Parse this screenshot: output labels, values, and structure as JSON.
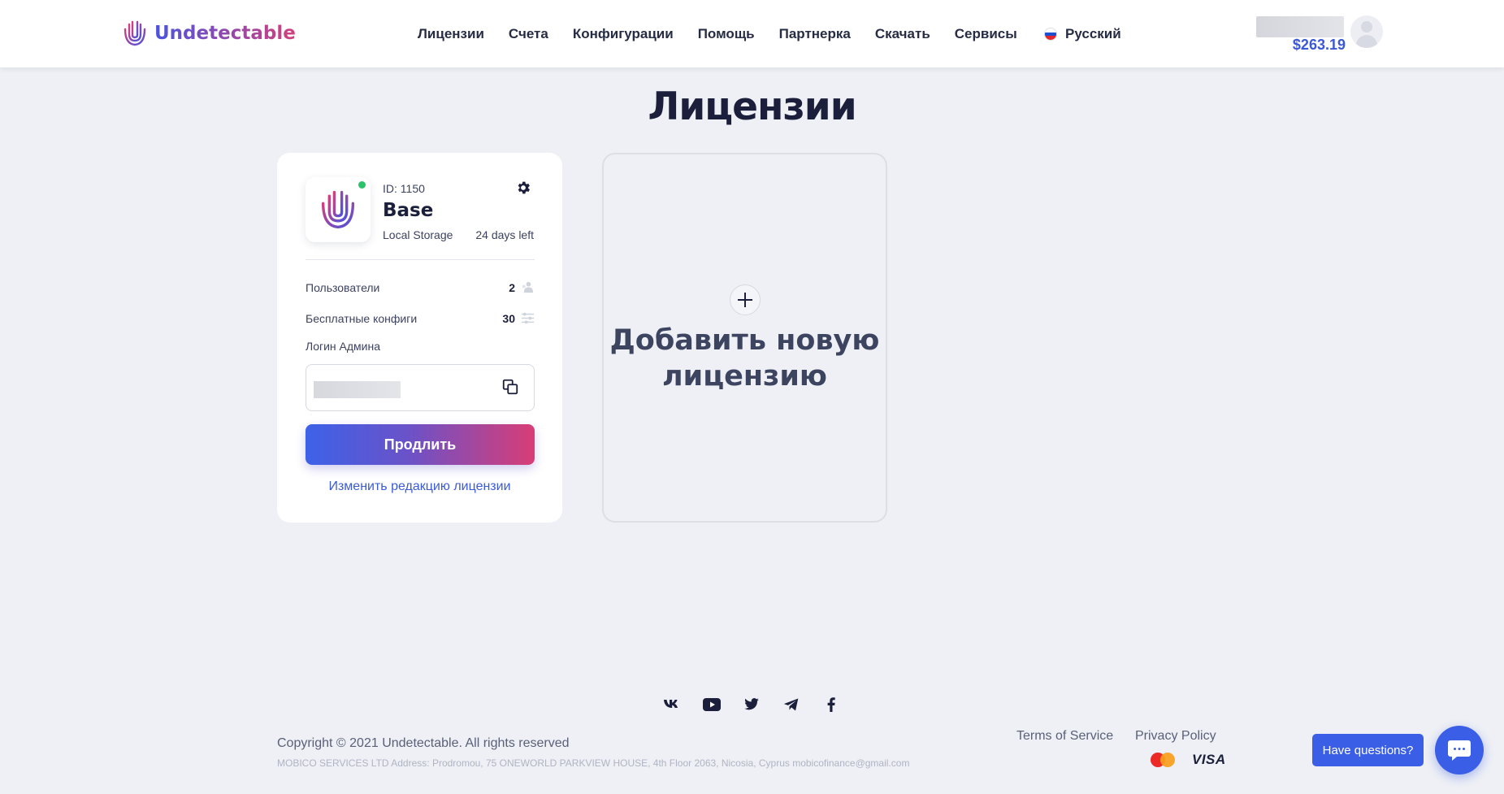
{
  "brand": {
    "name": "Undetectable"
  },
  "nav": {
    "items": [
      "Лицензии",
      "Счета",
      "Конфигурации",
      "Помощь",
      "Партнерка",
      "Скачать",
      "Сервисы"
    ],
    "language": "Русский"
  },
  "user": {
    "balance": "$263.19"
  },
  "page": {
    "title": "Лицензии"
  },
  "license": {
    "id": "ID: 1150",
    "name": "Base",
    "storage": "Local Storage",
    "days_left": "24 days left",
    "status_color": "#2bc26a",
    "users_label": "Пользователи",
    "users_value": "2",
    "configs_label": "Бесплатные конфиги",
    "configs_value": "30",
    "admin_login_label": "Логин Админа",
    "renew_label": "Продлить",
    "change_label": "Изменить редакцию лицензии"
  },
  "add_license": {
    "label": "Добавить новую лицензию"
  },
  "footer": {
    "socials": [
      "vk-icon",
      "youtube-icon",
      "twitter-icon",
      "telegram-icon",
      "facebook-icon"
    ],
    "copyright": "Copyright © 2021 Undetectable. All rights reserved",
    "address": "MOBICO SERVICES LTD Address: Prodromou, 75 ONEWORLD PARKVIEW HOUSE, 4th Floor 2063, Nicosia, Cyprus mobicofinance@gmail.com",
    "terms": "Terms of Service",
    "privacy": "Privacy Policy",
    "visa": "VISA"
  },
  "chat": {
    "questions_label": "Have questions?"
  },
  "colors": {
    "accent": "#3a5ee6",
    "gradient_start": "#3d62e8",
    "gradient_end": "#d93d76"
  }
}
